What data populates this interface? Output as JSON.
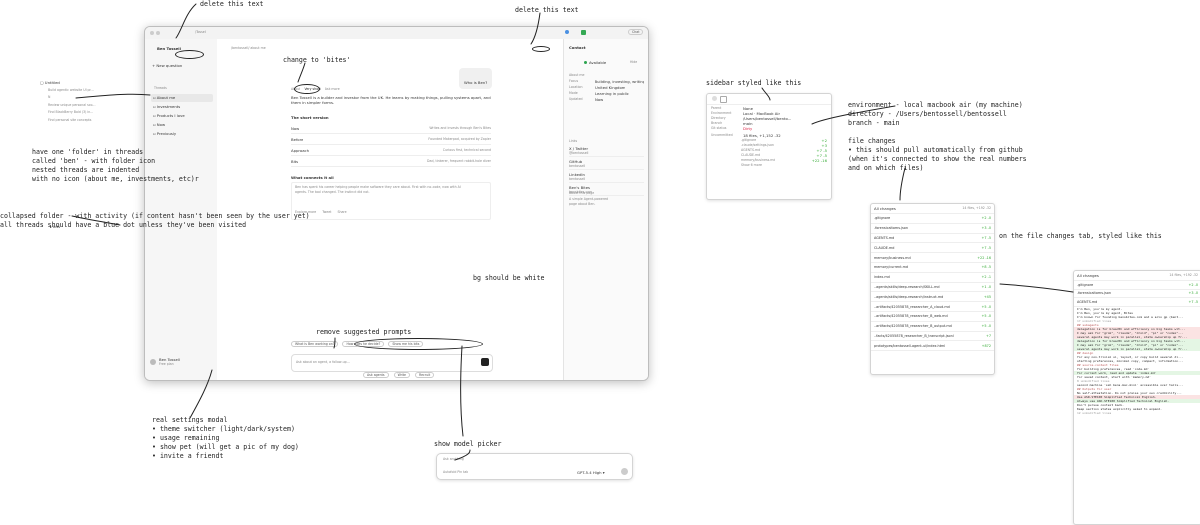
{
  "annotations": {
    "delete_left": "delete this text",
    "delete_right": "delete this text",
    "change_bites": "change to 'bites'",
    "sidebar_style": "sidebar styled like this",
    "environment": [
      "environment - local macbook air (my machine)",
      "directory - /Users/bentossell/bentossell",
      "branch - main"
    ],
    "file_changes": [
      "file changes",
      "• this should pull automatically from github",
      "  (when it's connected to show the real numbers",
      "  and on which files)"
    ],
    "folder_note": [
      "have one 'folder' in threads",
      "called 'ben' - with folder icon",
      "nested threads are indented",
      "with no icon (about me, investments, etc)r"
    ],
    "collapsed_note": [
      "collapsed folder - with activity (if content hasn't been seen by the user yet)",
      "all threads should have a blue dot unless they've been visited"
    ],
    "bg_white": "bg should be white",
    "remove_prompts": "remove suggested prompts",
    "file_tab_style": "on the file changes tab, styled like this",
    "settings_modal": [
      "real settings modal",
      "• theme switcher (light/dark/system)",
      "• usage remaining",
      "• show pet (will get a pic of my dog)",
      "• invite a friendt"
    ],
    "model_picker": "show model picker"
  },
  "left_sketch": {
    "folder": "Untitled",
    "items": [
      "Build agentic website UI pr...",
      "N",
      "Review unique personal sco...",
      "Find BlackBerry Bold (3) in...",
      "Find personal site concepts"
    ],
    "collapsed": "bits"
  },
  "app": {
    "breadcrumb_path": "/Tossell",
    "breadcrumb": "/bentossell/ about me",
    "user_name": "Ben Tossell",
    "new_question": "New question",
    "threads_header": "Threads",
    "threads": [
      "About me",
      "Investments",
      "Products I love",
      "Now",
      "Previously"
    ],
    "footer_user": "Ben Tossell",
    "footer_sub": "Free plan",
    "chat_button": "Chat",
    "question": "Who is Ben?",
    "tabs": [
      "About",
      "Very short",
      "Ask more"
    ],
    "answer_lines": [
      "Ben Tossell is a builder and investor from the UK. He learns by making things, pulling systems apart, and rebuilding",
      "them in simpler forms."
    ],
    "short_version_title": "The short version",
    "short_version": [
      {
        "k": "Now",
        "v": "Writes and invests through Ben's Bites"
      },
      {
        "k": "Before",
        "v": "Founded Makerpad, acquired by Zapier"
      },
      {
        "k": "Approach",
        "v": "Curious first, technical second"
      },
      {
        "k": "Bits",
        "v": "Dad, tinkerer, frequent rabbit-hole diver"
      }
    ],
    "connects_title": "What connects it all",
    "connects_lines": [
      "Ben has spent his career helping people make software they care about. First with no-code, now with AI",
      "agents. The tool changed. The instinct did not."
    ],
    "connects_footer": [
      "Explore more",
      "Tweet",
      "Share"
    ],
    "suggested_prompts": [
      "What is Ben working on?",
      "How does he decide?",
      "Show me his bits"
    ],
    "input_placeholder": "Ask about an agent, a follow-up…",
    "mode_tabs": [
      "Ask agents",
      "Write",
      "Recruit"
    ],
    "right_panel": {
      "header": "Contact",
      "status": "Available",
      "status_side": "Hide",
      "about_title": "About me",
      "about": [
        {
          "k": "Focus",
          "v": "Building, investing, writing"
        },
        {
          "k": "Location",
          "v": "United Kingdom"
        },
        {
          "k": "Mode",
          "v": "Learning in public"
        },
        {
          "k": "Updated",
          "v": "Now"
        }
      ],
      "links_title": "Links",
      "links": [
        {
          "name": "X / Twitter",
          "sub": "@bentossell"
        },
        {
          "name": "GitHub",
          "sub": "bentossell"
        },
        {
          "name": "LinkedIn",
          "sub": "bentossell"
        },
        {
          "name": "Ben's Bites",
          "sub": "bensbites.com"
        }
      ],
      "footer_title": "About this page",
      "footer_lines": [
        "A simple Agent-powered",
        "page about Ben."
      ]
    }
  },
  "sidebar_mock": {
    "rows": [
      {
        "k": "Parent",
        "v": "None"
      },
      {
        "k": "Environment",
        "v": "Local · MacBook Air"
      },
      {
        "k": "Directory",
        "v": "/Users/bentossell/bento..."
      },
      {
        "k": "Branch",
        "v": "main"
      },
      {
        "k": "Git status",
        "v": "Dirty"
      }
    ],
    "uncommitted": "Uncommitted",
    "uncommitted_v": "18 files, +1,152 -32",
    "files": [
      {
        "name": ".gitignore",
        "v": "+2"
      },
      {
        "name": ".claude/settings.json",
        "v": "+3"
      },
      {
        "name": "AGENTS.md",
        "v": "+7 -5"
      },
      {
        "name": "CLAUDE.md",
        "v": "+7 -5"
      },
      {
        "name": "memory/business.md",
        "v": "+22 -16"
      }
    ],
    "show_more": "Show 6 more"
  },
  "file_changes_panel": {
    "filter": "All changes",
    "summary": "14 files, +192 -32",
    "files": [
      {
        "name": ".gitignore",
        "v": "+2 -0"
      },
      {
        "name": ".forensicaitoms.json",
        "v": "+3 -0"
      },
      {
        "name": "AGENTS.md",
        "v": "+7 -5"
      },
      {
        "name": "CLAUDE.md",
        "v": "+7 -5"
      },
      {
        "name": "memory/business.md",
        "v": "+22 -16"
      },
      {
        "name": "memory/current.md",
        "v": "+8 -5"
      },
      {
        "name": "index.md",
        "v": "+2 -1"
      },
      {
        "name": "..agents/skills/deep-research/SKILL.md",
        "v": "+1 -0"
      },
      {
        "name": "..agents/skills/deep-research/instruct.md",
        "v": "+45"
      },
      {
        "name": "..artifacts/42055878_researcher_A_claud.md",
        "v": "+5 -0"
      },
      {
        "name": "..artifacts/42055878_researcher_B_web.md",
        "v": "+5 -0"
      },
      {
        "name": "..artifacts/42055878_researcher_B_output.md",
        "v": "+5 -0"
      },
      {
        "name": "..facts/42055878_researcher_B_transcript.jsonl",
        "v": "+7"
      },
      {
        "name": "prototypes/bentossell-agent-ui/index.html",
        "v": "+872"
      }
    ]
  },
  "diff_panel": {
    "filter": "All changes",
    "summary": "14 files, +192 -32",
    "files": [
      {
        "name": ".gitignore",
        "v": "+2 -0"
      },
      {
        "name": ".forensicaitoms.json",
        "v": "+3 -0"
      },
      {
        "name": "AGENTS.md",
        "v": "+7 -5"
      }
    ],
    "code": [
      {
        "t": "I'm Ben, you're my agent.",
        "k": "n"
      },
      {
        "t": "I'm Ben, you're my agent, Bites",
        "k": "n"
      },
      {
        "t": "",
        "k": "n"
      },
      {
        "t": "I'm known for founding bensbites.com and a solo gp (bent...",
        "k": "n"
      },
      {
        "t": "",
        "k": "n"
      },
      {
        "t": "17 unmodified lines",
        "k": "s"
      },
      {
        "t": "",
        "k": "n"
      },
      {
        "t": "## subagents",
        "k": "h"
      },
      {
        "t": "",
        "k": "n"
      },
      {
        "t": "delegation is for breadth and efficiency on big tasks wit...",
        "k": "d"
      },
      {
        "t": "I may ask for \"grok\", \"claude\", \"droid\", \"pi\" or \"codex\"...",
        "k": "d"
      },
      {
        "t": "several agents may work in parallel, state ownership up fr...",
        "k": "d"
      },
      {
        "t": "delegation is for breadth and efficiency on big tasks wit...",
        "k": "a"
      },
      {
        "t": "I may ask for \"grok\", \"claude\", \"droid\", \"pi\" or \"codex\"...",
        "k": "a"
      },
      {
        "t": "several agents may work in parallel, state ownership up fr...",
        "k": "a"
      },
      {
        "t": "",
        "k": "n"
      },
      {
        "t": "## design",
        "k": "h"
      },
      {
        "t": "",
        "k": "n"
      },
      {
        "t": "for any non-trivial ui, layout, or copy build several di...",
        "k": "n"
      },
      {
        "t": "starting preferences, minimal copy, compact, information...",
        "k": "n"
      },
      {
        "t": "",
        "k": "n"
      },
      {
        "t": "## source-context files",
        "k": "h"
      },
      {
        "t": "",
        "k": "n"
      },
      {
        "t": "for building preferences, read `code.md`",
        "k": "n"
      },
      {
        "t": "for current work, read and update `index.md`",
        "k": "a"
      },
      {
        "t": "for saved context, start with `memory.md`",
        "k": "n"
      },
      {
        "t": "",
        "k": "n"
      },
      {
        "t": "8 unmodified lines",
        "k": "s"
      },
      {
        "t": "",
        "k": "n"
      },
      {
        "t": "second machine `ssh bens-mac-mini` accessible over tails...",
        "k": "n"
      },
      {
        "t": "",
        "k": "n"
      },
      {
        "t": "## Outputs for user",
        "k": "h"
      },
      {
        "t": "",
        "k": "n"
      },
      {
        "t": "No self-attestation. Do not praise your own credibility...",
        "k": "n"
      },
      {
        "t": "Use ASD-STE100 Simplified Technical English.",
        "k": "d"
      },
      {
        "t": "Always use ASD-STE100 Simplified Technical English.",
        "k": "a"
      },
      {
        "t": "Don't pursue context back.",
        "k": "n"
      },
      {
        "t": "Keep section states explicitly asked to expand.",
        "k": "n"
      },
      {
        "t": "",
        "k": "n"
      },
      {
        "t": "12 unmodified lines",
        "k": "s"
      }
    ]
  },
  "model_picker_mock": {
    "placeholder": "Ask anything",
    "left_label": "Autofold Pin tab",
    "model": "GPT-5.4 High"
  }
}
